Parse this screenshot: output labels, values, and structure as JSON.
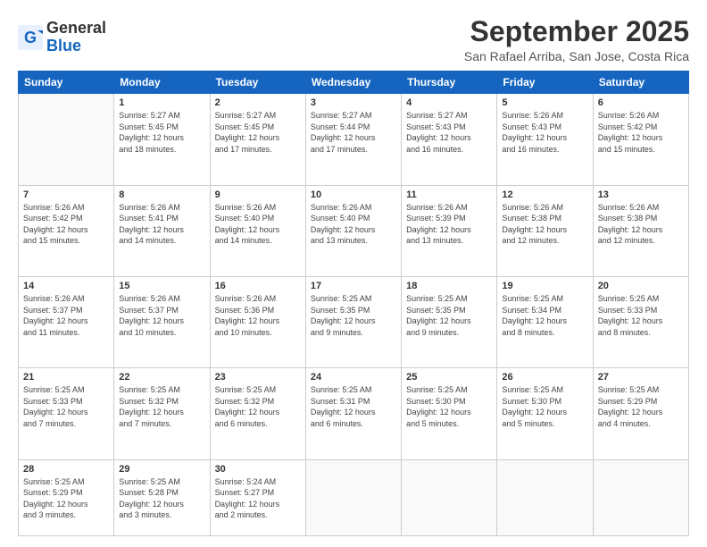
{
  "logo": {
    "line1": "General",
    "line2": "Blue"
  },
  "title": "September 2025",
  "subtitle": "San Rafael Arriba, San Jose, Costa Rica",
  "weekdays": [
    "Sunday",
    "Monday",
    "Tuesday",
    "Wednesday",
    "Thursday",
    "Friday",
    "Saturday"
  ],
  "weeks": [
    [
      {
        "day": "",
        "info": ""
      },
      {
        "day": "1",
        "info": "Sunrise: 5:27 AM\nSunset: 5:45 PM\nDaylight: 12 hours\nand 18 minutes."
      },
      {
        "day": "2",
        "info": "Sunrise: 5:27 AM\nSunset: 5:45 PM\nDaylight: 12 hours\nand 17 minutes."
      },
      {
        "day": "3",
        "info": "Sunrise: 5:27 AM\nSunset: 5:44 PM\nDaylight: 12 hours\nand 17 minutes."
      },
      {
        "day": "4",
        "info": "Sunrise: 5:27 AM\nSunset: 5:43 PM\nDaylight: 12 hours\nand 16 minutes."
      },
      {
        "day": "5",
        "info": "Sunrise: 5:26 AM\nSunset: 5:43 PM\nDaylight: 12 hours\nand 16 minutes."
      },
      {
        "day": "6",
        "info": "Sunrise: 5:26 AM\nSunset: 5:42 PM\nDaylight: 12 hours\nand 15 minutes."
      }
    ],
    [
      {
        "day": "7",
        "info": "Sunrise: 5:26 AM\nSunset: 5:42 PM\nDaylight: 12 hours\nand 15 minutes."
      },
      {
        "day": "8",
        "info": "Sunrise: 5:26 AM\nSunset: 5:41 PM\nDaylight: 12 hours\nand 14 minutes."
      },
      {
        "day": "9",
        "info": "Sunrise: 5:26 AM\nSunset: 5:40 PM\nDaylight: 12 hours\nand 14 minutes."
      },
      {
        "day": "10",
        "info": "Sunrise: 5:26 AM\nSunset: 5:40 PM\nDaylight: 12 hours\nand 13 minutes."
      },
      {
        "day": "11",
        "info": "Sunrise: 5:26 AM\nSunset: 5:39 PM\nDaylight: 12 hours\nand 13 minutes."
      },
      {
        "day": "12",
        "info": "Sunrise: 5:26 AM\nSunset: 5:38 PM\nDaylight: 12 hours\nand 12 minutes."
      },
      {
        "day": "13",
        "info": "Sunrise: 5:26 AM\nSunset: 5:38 PM\nDaylight: 12 hours\nand 12 minutes."
      }
    ],
    [
      {
        "day": "14",
        "info": "Sunrise: 5:26 AM\nSunset: 5:37 PM\nDaylight: 12 hours\nand 11 minutes."
      },
      {
        "day": "15",
        "info": "Sunrise: 5:26 AM\nSunset: 5:37 PM\nDaylight: 12 hours\nand 10 minutes."
      },
      {
        "day": "16",
        "info": "Sunrise: 5:26 AM\nSunset: 5:36 PM\nDaylight: 12 hours\nand 10 minutes."
      },
      {
        "day": "17",
        "info": "Sunrise: 5:25 AM\nSunset: 5:35 PM\nDaylight: 12 hours\nand 9 minutes."
      },
      {
        "day": "18",
        "info": "Sunrise: 5:25 AM\nSunset: 5:35 PM\nDaylight: 12 hours\nand 9 minutes."
      },
      {
        "day": "19",
        "info": "Sunrise: 5:25 AM\nSunset: 5:34 PM\nDaylight: 12 hours\nand 8 minutes."
      },
      {
        "day": "20",
        "info": "Sunrise: 5:25 AM\nSunset: 5:33 PM\nDaylight: 12 hours\nand 8 minutes."
      }
    ],
    [
      {
        "day": "21",
        "info": "Sunrise: 5:25 AM\nSunset: 5:33 PM\nDaylight: 12 hours\nand 7 minutes."
      },
      {
        "day": "22",
        "info": "Sunrise: 5:25 AM\nSunset: 5:32 PM\nDaylight: 12 hours\nand 7 minutes."
      },
      {
        "day": "23",
        "info": "Sunrise: 5:25 AM\nSunset: 5:32 PM\nDaylight: 12 hours\nand 6 minutes."
      },
      {
        "day": "24",
        "info": "Sunrise: 5:25 AM\nSunset: 5:31 PM\nDaylight: 12 hours\nand 6 minutes."
      },
      {
        "day": "25",
        "info": "Sunrise: 5:25 AM\nSunset: 5:30 PM\nDaylight: 12 hours\nand 5 minutes."
      },
      {
        "day": "26",
        "info": "Sunrise: 5:25 AM\nSunset: 5:30 PM\nDaylight: 12 hours\nand 5 minutes."
      },
      {
        "day": "27",
        "info": "Sunrise: 5:25 AM\nSunset: 5:29 PM\nDaylight: 12 hours\nand 4 minutes."
      }
    ],
    [
      {
        "day": "28",
        "info": "Sunrise: 5:25 AM\nSunset: 5:29 PM\nDaylight: 12 hours\nand 3 minutes."
      },
      {
        "day": "29",
        "info": "Sunrise: 5:25 AM\nSunset: 5:28 PM\nDaylight: 12 hours\nand 3 minutes."
      },
      {
        "day": "30",
        "info": "Sunrise: 5:24 AM\nSunset: 5:27 PM\nDaylight: 12 hours\nand 2 minutes."
      },
      {
        "day": "",
        "info": ""
      },
      {
        "day": "",
        "info": ""
      },
      {
        "day": "",
        "info": ""
      },
      {
        "day": "",
        "info": ""
      }
    ]
  ]
}
